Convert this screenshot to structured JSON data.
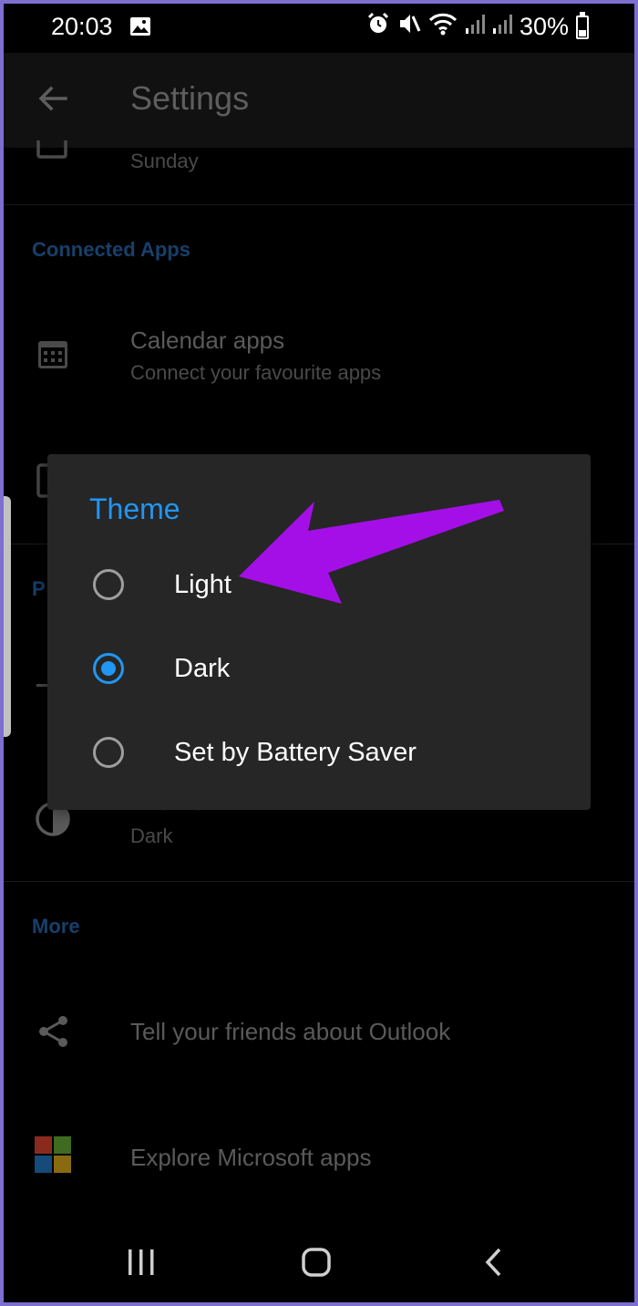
{
  "status_bar": {
    "time": "20:03",
    "battery": "30%",
    "battery_level": 0.3
  },
  "app_bar": {
    "title": "Settings"
  },
  "settings": {
    "week_start_value": "Sunday",
    "connected_apps_header": "Connected Apps",
    "calendar_apps_title": "Calendar apps",
    "calendar_apps_sub": "Connect your favourite apps",
    "partial_header": "P",
    "theme_title": "Theme",
    "theme_value": "Dark",
    "more_header": "More",
    "tell_friends": "Tell your friends about Outlook",
    "explore_apps": "Explore Microsoft apps"
  },
  "theme_dialog": {
    "title": "Theme",
    "options": [
      {
        "label": "Light",
        "selected": false
      },
      {
        "label": "Dark",
        "selected": true
      },
      {
        "label": "Set by Battery Saver",
        "selected": false
      }
    ]
  },
  "colors": {
    "accent": "#2196f3",
    "annotation_arrow": "#a40fe8",
    "frame_border": "#7c6fd0"
  },
  "icons": [
    "gallery-icon",
    "alarm-icon",
    "mute-icon",
    "wifi-icon",
    "signal-icon",
    "battery-icon",
    "back-arrow-icon",
    "calendar-icon",
    "theme-icon",
    "share-icon",
    "microsoft-logo-icon",
    "recents-icon",
    "home-icon",
    "nav-back-icon"
  ]
}
